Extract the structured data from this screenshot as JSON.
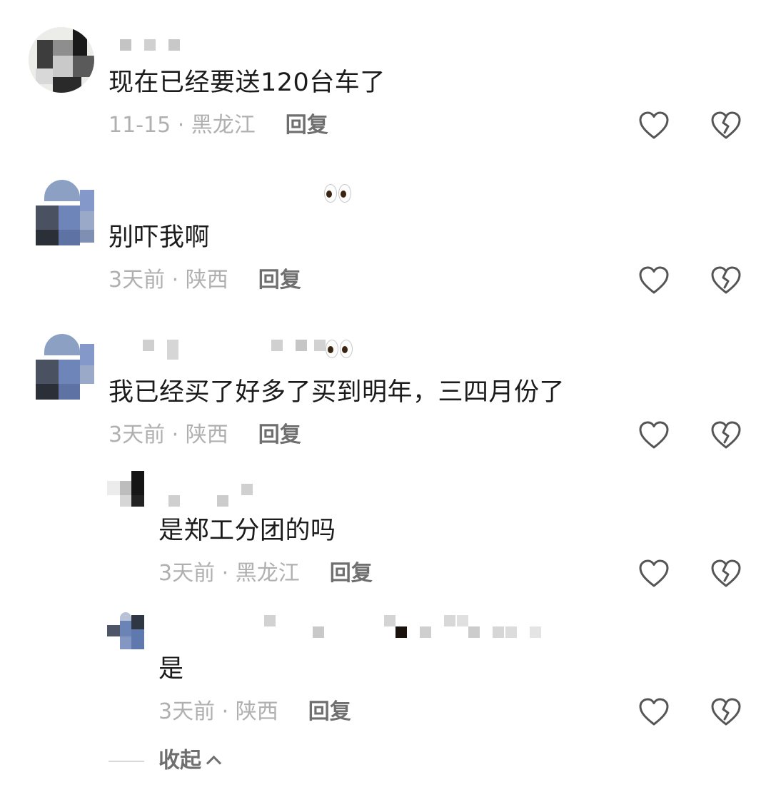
{
  "comments": [
    {
      "text": "现在已经要送120台车了",
      "time": "11-15 · 黑龙江",
      "reply": "回复"
    },
    {
      "text": "别吓我啊",
      "time": "3天前 · 陕西",
      "reply": "回复"
    },
    {
      "text": "我已经买了好多了买到明年，三四月份了",
      "time": "3天前 · 陕西",
      "reply": "回复"
    },
    {
      "text": "是郑工分团的吗",
      "time": "3天前 · 黑龙江",
      "reply": "回复"
    },
    {
      "text": "是",
      "time": "3天前 · 陕西",
      "reply": "回复"
    }
  ],
  "collapse_label": "收起",
  "icons": {
    "like": "heart-outline-icon",
    "dislike": "broken-heart-outline-icon",
    "collapse": "chevron-up-icon"
  },
  "colors": {
    "text": "#1b1b1b",
    "meta": "#b0b0b0",
    "reply": "#6f6f6f",
    "icon": "#555555"
  }
}
